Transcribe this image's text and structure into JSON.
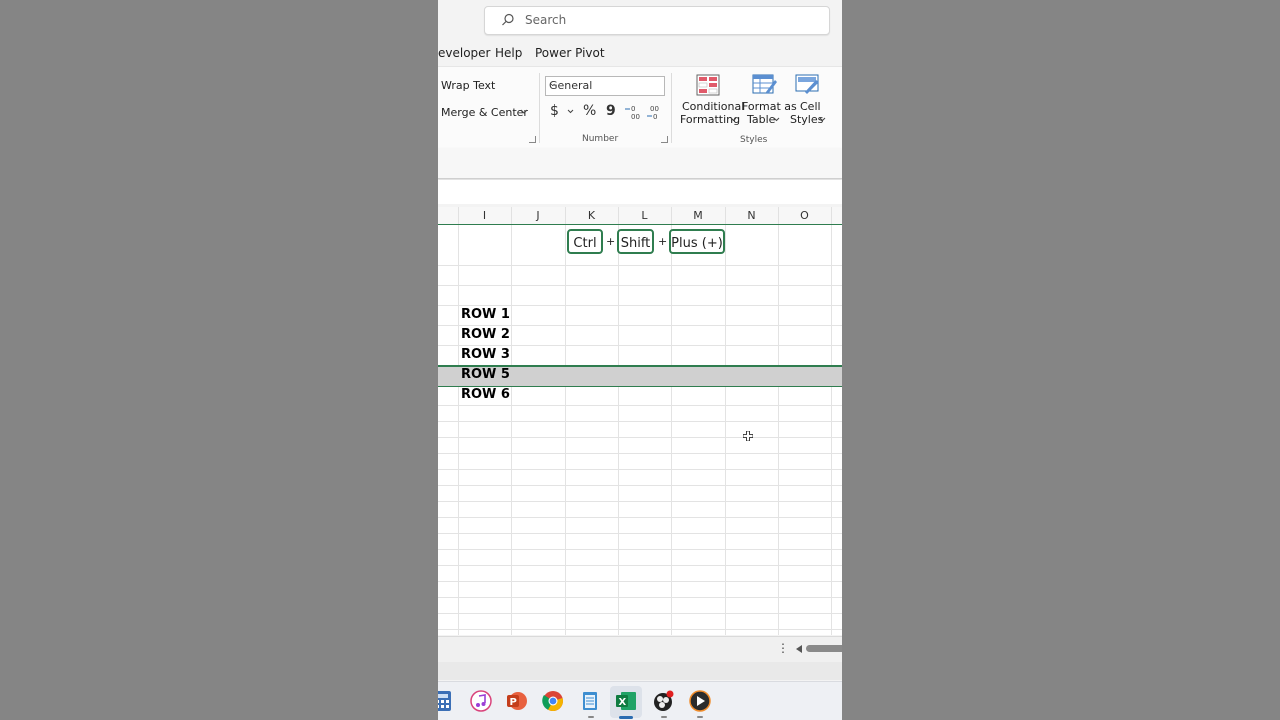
{
  "search": {
    "placeholder": "Search"
  },
  "tabs": [
    "eveloper",
    "Help",
    "Power Pivot"
  ],
  "ribbon": {
    "alignment": {
      "wrap_text": "Wrap Text",
      "merge_center": "Merge & Center"
    },
    "number": {
      "format_value": "General",
      "currency_symbol": "$",
      "percent_symbol": "%",
      "comma_symbol": "9",
      "group_label": "Number"
    },
    "styles": {
      "conditional_1": "Conditional",
      "conditional_2": "Formatting",
      "format_table_1": "Format as",
      "format_table_2": "Table",
      "cell_styles_1": "Cell",
      "cell_styles_2": "Styles",
      "group_label": "Styles"
    }
  },
  "columns": [
    "I",
    "J",
    "K",
    "L",
    "M",
    "N",
    "O"
  ],
  "shortcut": {
    "keys": [
      "Ctrl",
      "Shift",
      "Plus (+)"
    ],
    "separator": "+"
  },
  "rows": [
    "ROW 1",
    "ROW 2",
    "ROW 3",
    "ROW 5",
    "ROW 6"
  ],
  "colors": {
    "accent": "#2f7d4f",
    "selected_row": "#d0d0d0",
    "background": "#858585"
  },
  "taskbar_icons": [
    "calculator-icon",
    "itunes-icon",
    "powerpoint-icon",
    "chrome-icon",
    "notepad-icon",
    "excel-icon",
    "obs-icon",
    "media-player-icon"
  ]
}
